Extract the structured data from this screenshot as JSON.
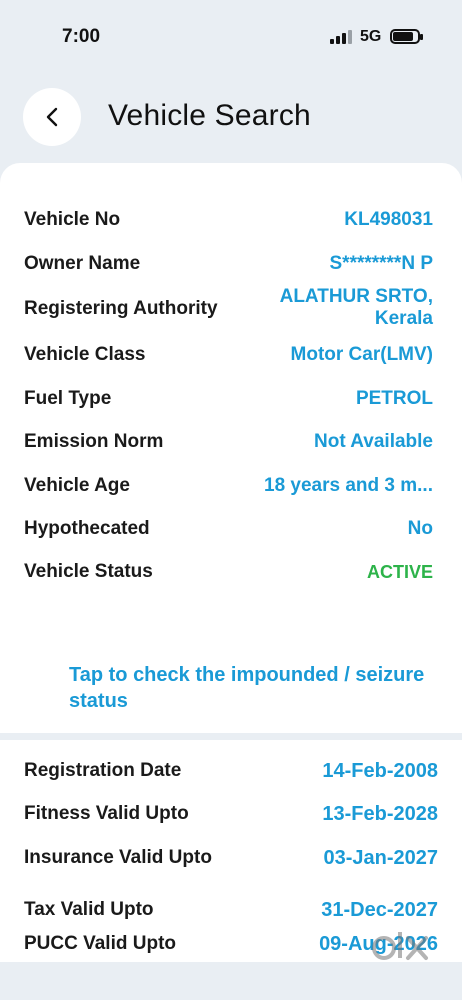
{
  "status_bar": {
    "time": "7:00",
    "network": "5G"
  },
  "header": {
    "title": "Vehicle Search"
  },
  "vehicle_details": [
    {
      "label": "Vehicle No",
      "value": "KL498031"
    },
    {
      "label": "Owner Name",
      "value": "S********N P"
    },
    {
      "label": "Registering Authority",
      "value": "ALATHUR SRTO, Kerala"
    },
    {
      "label": "Vehicle Class",
      "value": "Motor Car(LMV)"
    },
    {
      "label": "Fuel Type",
      "value": "PETROL"
    },
    {
      "label": "Emission Norm",
      "value": "Not Available"
    },
    {
      "label": "Vehicle Age",
      "value": "18 years and 3 m..."
    },
    {
      "label": "Hypothecated",
      "value": "No"
    },
    {
      "label": "Vehicle Status",
      "value": "ACTIVE"
    }
  ],
  "impound_link": "Tap to check the impounded / seizure status",
  "validity": [
    {
      "label": "Registration Date",
      "value": "14-Feb-2008"
    },
    {
      "label": "Fitness Valid Upto",
      "value": "13-Feb-2028"
    },
    {
      "label": "Insurance Valid Upto",
      "value": "03-Jan-2027"
    },
    {
      "label": "Tax Valid Upto",
      "value": "31-Dec-2027"
    },
    {
      "label": "PUCC Valid Upto",
      "value": "09-Aug-2026"
    }
  ],
  "colors": {
    "accent": "#1a9ad6",
    "active": "#2db34a",
    "background": "#e9eef3"
  },
  "watermark": {
    "logo_text": "olx"
  }
}
